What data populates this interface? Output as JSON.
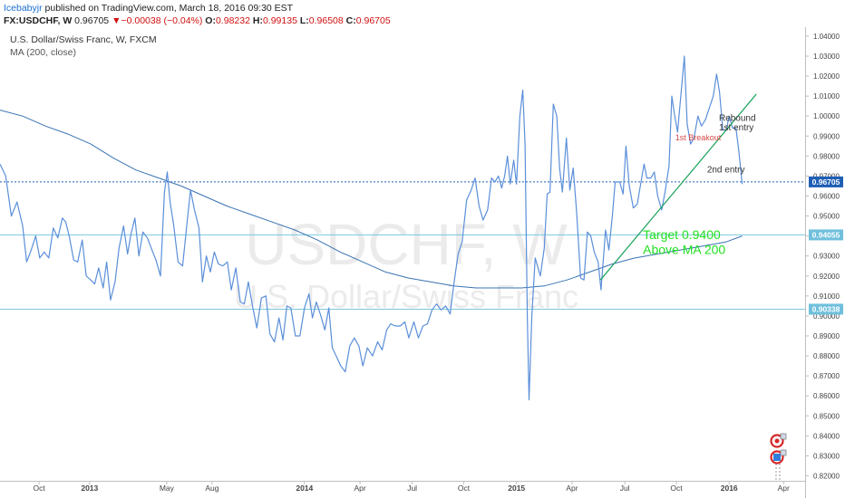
{
  "header": {
    "author": "Icebabyjr",
    "published": "published on TradingView.com, March 18, 2016 09:30 EST",
    "symbol": "FX:USDCHF, W",
    "last": "0.96705",
    "change_arrow": "▼",
    "change": "−0.00038 (−0.04%)",
    "o_label": "O:",
    "o_val": "0.98232",
    "h_label": "H:",
    "h_val": "0.99135",
    "l_label": "L:",
    "l_val": "0.96508",
    "c_label": "C:",
    "c_val": "0.96705"
  },
  "legend": {
    "title": "U.S. Dollar/Swiss Franc, W, FXCM",
    "ma": "MA (200, close)"
  },
  "watermark": {
    "symbol": "USDCHF, W",
    "name": "U.S. Dollar/Swiss Franc"
  },
  "chart_data": {
    "type": "line",
    "title": "U.S. Dollar/Swiss Franc, W, FXCM",
    "y_ticks": [
      "1.04000",
      "1.03000",
      "1.02000",
      "1.01000",
      "1.00000",
      "0.99000",
      "0.98000",
      "0.97000",
      "0.96000",
      "0.95000",
      "0.94000",
      "0.93000",
      "0.92000",
      "0.91000",
      "0.90000",
      "0.89000",
      "0.88000",
      "0.87000",
      "0.86000",
      "0.85000",
      "0.84000",
      "0.83000",
      "0.82000"
    ],
    "ylim": [
      0.8175,
      1.0445
    ],
    "x_ticks": [
      {
        "label": "Oct",
        "x": 0.069
      },
      {
        "label": "2013",
        "x": 0.158
      },
      {
        "label": "May",
        "x": 0.294
      },
      {
        "label": "Aug",
        "x": 0.374
      },
      {
        "label": "2014",
        "x": 0.537
      },
      {
        "label": "Apr",
        "x": 0.635
      },
      {
        "label": "Jul",
        "x": 0.727
      },
      {
        "label": "Oct",
        "x": 0.818
      },
      {
        "label": "2015",
        "x": 0.911
      },
      {
        "label": "Apr",
        "x": 1.009
      },
      {
        "label": "Jul",
        "x": 1.102
      },
      {
        "label": "Oct",
        "x": 1.193
      },
      {
        "label": "2016",
        "x": 1.286
      },
      {
        "label": "Apr",
        "x": 1.382
      }
    ],
    "xlim": [
      0,
      1.42
    ],
    "series": [
      {
        "name": "USDCHF weekly close",
        "color": "#5b8fd9",
        "points": [
          [
            0.0,
            0.976
          ],
          [
            0.01,
            0.97
          ],
          [
            0.02,
            0.95
          ],
          [
            0.03,
            0.957
          ],
          [
            0.04,
            0.945
          ],
          [
            0.047,
            0.927
          ],
          [
            0.055,
            0.933
          ],
          [
            0.063,
            0.94
          ],
          [
            0.07,
            0.929
          ],
          [
            0.078,
            0.932
          ],
          [
            0.086,
            0.929
          ],
          [
            0.094,
            0.944
          ],
          [
            0.102,
            0.939
          ],
          [
            0.11,
            0.949
          ],
          [
            0.116,
            0.947
          ],
          [
            0.122,
            0.94
          ],
          [
            0.13,
            0.928
          ],
          [
            0.137,
            0.927
          ],
          [
            0.145,
            0.938
          ],
          [
            0.152,
            0.92
          ],
          [
            0.16,
            0.918
          ],
          [
            0.167,
            0.916
          ],
          [
            0.174,
            0.924
          ],
          [
            0.182,
            0.914
          ],
          [
            0.188,
            0.927
          ],
          [
            0.195,
            0.908
          ],
          [
            0.203,
            0.917
          ],
          [
            0.21,
            0.934
          ],
          [
            0.218,
            0.945
          ],
          [
            0.225,
            0.931
          ],
          [
            0.231,
            0.941
          ],
          [
            0.238,
            0.949
          ],
          [
            0.245,
            0.93
          ],
          [
            0.252,
            0.942
          ],
          [
            0.26,
            0.939
          ],
          [
            0.268,
            0.933
          ],
          [
            0.275,
            0.928
          ],
          [
            0.283,
            0.92
          ],
          [
            0.29,
            0.962
          ],
          [
            0.295,
            0.972
          ],
          [
            0.3,
            0.957
          ],
          [
            0.306,
            0.946
          ],
          [
            0.314,
            0.927
          ],
          [
            0.322,
            0.925
          ],
          [
            0.33,
            0.947
          ],
          [
            0.336,
            0.963
          ],
          [
            0.343,
            0.953
          ],
          [
            0.351,
            0.944
          ],
          [
            0.357,
            0.917
          ],
          [
            0.364,
            0.93
          ],
          [
            0.371,
            0.922
          ],
          [
            0.378,
            0.932
          ],
          [
            0.385,
            0.926
          ],
          [
            0.393,
            0.925
          ],
          [
            0.401,
            0.927
          ],
          [
            0.408,
            0.913
          ],
          [
            0.416,
            0.924
          ],
          [
            0.424,
            0.907
          ],
          [
            0.431,
            0.906
          ],
          [
            0.438,
            0.917
          ],
          [
            0.446,
            0.904
          ],
          [
            0.453,
            0.894
          ],
          [
            0.461,
            0.909
          ],
          [
            0.469,
            0.91
          ],
          [
            0.476,
            0.891
          ],
          [
            0.484,
            0.887
          ],
          [
            0.492,
            0.899
          ],
          [
            0.499,
            0.888
          ],
          [
            0.506,
            0.905
          ],
          [
            0.513,
            0.904
          ],
          [
            0.521,
            0.89
          ],
          [
            0.529,
            0.89
          ],
          [
            0.537,
            0.904
          ],
          [
            0.545,
            0.911
          ],
          [
            0.551,
            0.899
          ],
          [
            0.558,
            0.907
          ],
          [
            0.566,
            0.9
          ],
          [
            0.573,
            0.893
          ],
          [
            0.58,
            0.904
          ],
          [
            0.586,
            0.884
          ],
          [
            0.593,
            0.88
          ],
          [
            0.601,
            0.875
          ],
          [
            0.609,
            0.872
          ],
          [
            0.617,
            0.885
          ],
          [
            0.625,
            0.889
          ],
          [
            0.633,
            0.885
          ],
          [
            0.64,
            0.875
          ],
          [
            0.648,
            0.884
          ],
          [
            0.657,
            0.88
          ],
          [
            0.666,
            0.887
          ],
          [
            0.674,
            0.883
          ],
          [
            0.682,
            0.893
          ],
          [
            0.689,
            0.896
          ],
          [
            0.697,
            0.895
          ],
          [
            0.706,
            0.895
          ],
          [
            0.714,
            0.897
          ],
          [
            0.721,
            0.889
          ],
          [
            0.73,
            0.897
          ],
          [
            0.738,
            0.889
          ],
          [
            0.746,
            0.895
          ],
          [
            0.754,
            0.896
          ],
          [
            0.762,
            0.903
          ],
          [
            0.77,
            0.906
          ],
          [
            0.778,
            0.903
          ],
          [
            0.786,
            0.905
          ],
          [
            0.794,
            0.901
          ],
          [
            0.801,
            0.917
          ],
          [
            0.808,
            0.931
          ],
          [
            0.815,
            0.937
          ],
          [
            0.823,
            0.958
          ],
          [
            0.831,
            0.963
          ],
          [
            0.838,
            0.969
          ],
          [
            0.845,
            0.955
          ],
          [
            0.852,
            0.948
          ],
          [
            0.86,
            0.953
          ],
          [
            0.867,
            0.969
          ],
          [
            0.873,
            0.967
          ],
          [
            0.879,
            0.97
          ],
          [
            0.885,
            0.964
          ],
          [
            0.89,
            0.97
          ],
          [
            0.895,
            0.98
          ],
          [
            0.9,
            0.966
          ],
          [
            0.906,
            0.978
          ],
          [
            0.911,
            0.966
          ],
          [
            0.917,
            1.0
          ],
          [
            0.922,
            1.013
          ],
          [
            0.926,
            0.986
          ],
          [
            0.93,
            0.9
          ],
          [
            0.933,
            0.858
          ],
          [
            0.938,
            0.9
          ],
          [
            0.944,
            0.929
          ],
          [
            0.953,
            0.92
          ],
          [
            0.96,
            0.934
          ],
          [
            0.965,
            0.961
          ],
          [
            0.97,
            0.962
          ],
          [
            0.976,
            1.006
          ],
          [
            0.982,
            1.0
          ],
          [
            0.987,
            0.974
          ],
          [
            0.992,
            0.962
          ],
          [
            0.999,
            0.989
          ],
          [
            1.005,
            0.963
          ],
          [
            1.011,
            0.974
          ],
          [
            1.017,
            0.952
          ],
          [
            1.024,
            0.919
          ],
          [
            1.03,
            0.918
          ],
          [
            1.036,
            0.942
          ],
          [
            1.042,
            0.94
          ],
          [
            1.048,
            0.932
          ],
          [
            1.055,
            0.927
          ],
          [
            1.06,
            0.913
          ],
          [
            1.068,
            0.943
          ],
          [
            1.074,
            0.933
          ],
          [
            1.08,
            0.95
          ],
          [
            1.085,
            0.967
          ],
          [
            1.093,
            0.967
          ],
          [
            1.099,
            0.961
          ],
          [
            1.104,
            0.985
          ],
          [
            1.11,
            0.965
          ],
          [
            1.117,
            0.954
          ],
          [
            1.124,
            0.956
          ],
          [
            1.13,
            0.966
          ],
          [
            1.136,
            0.976
          ],
          [
            1.141,
            0.969
          ],
          [
            1.148,
            0.969
          ],
          [
            1.154,
            0.972
          ],
          [
            1.16,
            0.96
          ],
          [
            1.167,
            0.953
          ],
          [
            1.173,
            0.962
          ],
          [
            1.18,
            0.975
          ],
          [
            1.185,
            1.01
          ],
          [
            1.189,
            1.002
          ],
          [
            1.195,
            0.992
          ],
          [
            1.203,
            1.017
          ],
          [
            1.207,
            1.03
          ],
          [
            1.212,
            0.996
          ],
          [
            1.218,
            0.986
          ],
          [
            1.224,
            0.989
          ],
          [
            1.231,
            1.0
          ],
          [
            1.237,
            0.995
          ],
          [
            1.244,
            0.998
          ],
          [
            1.251,
            1.004
          ],
          [
            1.258,
            1.01
          ],
          [
            1.264,
            1.021
          ],
          [
            1.269,
            1.012
          ],
          [
            1.275,
            0.993
          ],
          [
            1.281,
            0.993
          ],
          [
            1.286,
            1.0
          ],
          [
            1.292,
            0.994
          ],
          [
            1.298,
            0.994
          ],
          [
            1.303,
            0.983
          ],
          [
            1.309,
            0.966
          ]
        ]
      },
      {
        "name": "MA (200, close)",
        "color": "#3a73b3",
        "points": [
          [
            0.0,
            1.003
          ],
          [
            0.04,
            1.0
          ],
          [
            0.08,
            0.995
          ],
          [
            0.12,
            0.991
          ],
          [
            0.16,
            0.986
          ],
          [
            0.2,
            0.979
          ],
          [
            0.24,
            0.973
          ],
          [
            0.28,
            0.969
          ],
          [
            0.32,
            0.965
          ],
          [
            0.36,
            0.96
          ],
          [
            0.4,
            0.955
          ],
          [
            0.44,
            0.951
          ],
          [
            0.48,
            0.947
          ],
          [
            0.52,
            0.943
          ],
          [
            0.56,
            0.938
          ],
          [
            0.6,
            0.932
          ],
          [
            0.64,
            0.927
          ],
          [
            0.68,
            0.922
          ],
          [
            0.72,
            0.919
          ],
          [
            0.76,
            0.917
          ],
          [
            0.8,
            0.915
          ],
          [
            0.84,
            0.914
          ],
          [
            0.88,
            0.914
          ],
          [
            0.92,
            0.914
          ],
          [
            0.96,
            0.915
          ],
          [
            1.0,
            0.918
          ],
          [
            1.04,
            0.922
          ],
          [
            1.08,
            0.926
          ],
          [
            1.12,
            0.929
          ],
          [
            1.16,
            0.931
          ],
          [
            1.2,
            0.933
          ],
          [
            1.24,
            0.935
          ],
          [
            1.28,
            0.937
          ],
          [
            1.309,
            0.94
          ]
        ]
      }
    ],
    "hlines": [
      {
        "value": 0.96705,
        "label": "0.96705",
        "color": "#1f5fb5",
        "style": "dotted"
      },
      {
        "value": 0.94055,
        "label": "0.94055",
        "color": "#79c7df",
        "style": "solid"
      },
      {
        "value": 0.90338,
        "label": "0.90338",
        "color": "#79c7df",
        "style": "solid"
      }
    ],
    "trendlines": [
      {
        "from": [
          1.059,
          0.918
        ],
        "to": [
          1.334,
          1.011
        ],
        "color": "#19a35a"
      }
    ],
    "annotations": [
      {
        "text": "Rebound",
        "x": 1.268,
        "y": 0.9975,
        "color": "#333333",
        "size": 10
      },
      {
        "text": "1st entry",
        "x": 1.268,
        "y": 0.9928,
        "color": "#333333",
        "size": 10
      },
      {
        "text": "1st Breakout",
        "x": 1.191,
        "y": 0.9878,
        "color": "#d84848",
        "size": 9
      },
      {
        "text": "2nd entry",
        "x": 1.247,
        "y": 0.9717,
        "color": "#333333",
        "size": 10
      },
      {
        "text": "Target 0.9400",
        "x": 1.134,
        "y": 0.9385,
        "color": "#21e021",
        "size": 14
      },
      {
        "text": "Above MA 200",
        "x": 1.134,
        "y": 0.931,
        "color": "#21e021",
        "size": 14
      }
    ],
    "label_colors": {
      "price": "#1f5fb5",
      "level": "#6fc0dc"
    },
    "grid": false
  }
}
